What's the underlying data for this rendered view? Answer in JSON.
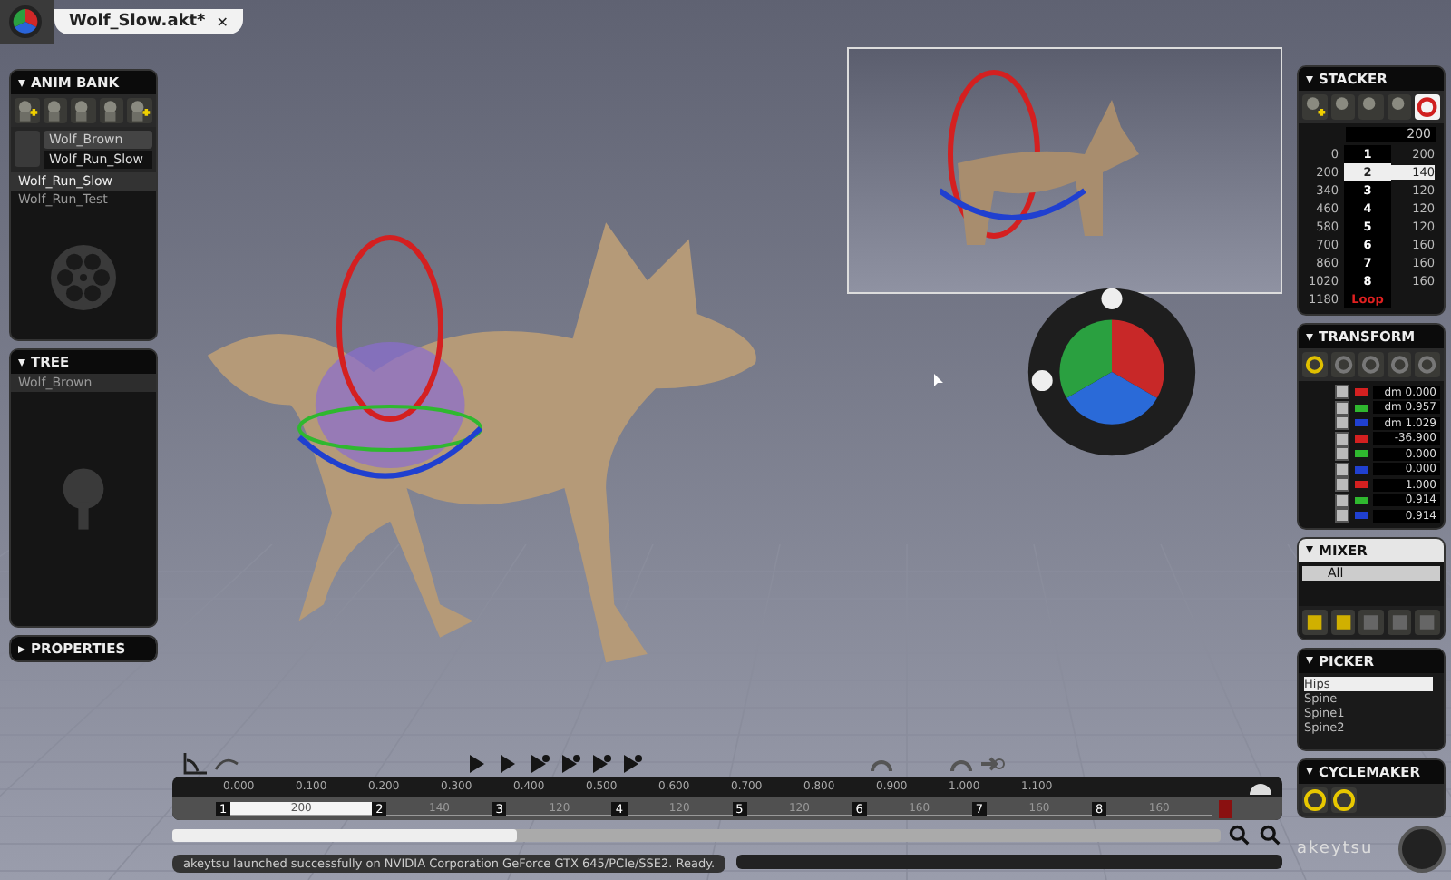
{
  "window": {
    "title": "Wolf_Slow.akt*",
    "close": "✕"
  },
  "anim_bank": {
    "title": "ANIM BANK",
    "expanded": true,
    "character": "Wolf_Brown",
    "current": "Wolf_Run_Slow",
    "items": [
      {
        "label": "Wolf_Run_Slow",
        "selected": true
      },
      {
        "label": "Wolf_Run_Test",
        "selected": false
      }
    ]
  },
  "tree": {
    "title": "TREE",
    "expanded": true,
    "items": [
      {
        "label": "Wolf_Brown"
      }
    ]
  },
  "properties": {
    "title": "PROPERTIES",
    "expanded": false
  },
  "stacker": {
    "title": "STACKER",
    "expanded": true,
    "top_value": "200",
    "rows": [
      {
        "time": "0",
        "clip": "1",
        "duration": "200",
        "kind": "clip",
        "selected": false
      },
      {
        "time": "200",
        "clip": "2",
        "duration": "140",
        "kind": "clip",
        "selected": true
      },
      {
        "time": "340",
        "clip": "3",
        "duration": "120",
        "kind": "clip",
        "selected": false
      },
      {
        "time": "460",
        "clip": "4",
        "duration": "120",
        "kind": "clip",
        "selected": false
      },
      {
        "time": "580",
        "clip": "5",
        "duration": "120",
        "kind": "clip",
        "selected": false
      },
      {
        "time": "700",
        "clip": "6",
        "duration": "160",
        "kind": "clip",
        "selected": false
      },
      {
        "time": "860",
        "clip": "7",
        "duration": "160",
        "kind": "clip",
        "selected": false
      },
      {
        "time": "1020",
        "clip": "8",
        "duration": "160",
        "kind": "clip",
        "selected": false
      },
      {
        "time": "1180",
        "clip": "Loop",
        "kind": "loop",
        "selected": false
      }
    ]
  },
  "transform": {
    "title": "TRANSFORM",
    "expanded": true,
    "rows": [
      {
        "value": "dm 0.000",
        "checked": true,
        "color": "#d42020"
      },
      {
        "value": "dm 0.957",
        "checked": true,
        "color": "#2fb82f"
      },
      {
        "value": "dm 1.029",
        "checked": true,
        "color": "#2040d0"
      },
      {
        "value": "-36.900",
        "checked": true,
        "color": "#d42020"
      },
      {
        "value": "0.000",
        "checked": true,
        "color": "#2fb82f"
      },
      {
        "value": "0.000",
        "checked": true,
        "color": "#2040d0"
      },
      {
        "value": "1.000",
        "checked": true,
        "color": "#d42020"
      },
      {
        "value": "0.914",
        "checked": true,
        "color": "#2fb82f"
      },
      {
        "value": "0.914",
        "checked": true,
        "color": "#2040d0"
      }
    ]
  },
  "mixer": {
    "title": "MIXER",
    "expanded": true,
    "filter": "All"
  },
  "picker": {
    "title": "PICKER",
    "expanded": true,
    "items": [
      {
        "label": "Hips",
        "selected": true
      },
      {
        "label": "Spine",
        "selected": false
      },
      {
        "label": "Spine1",
        "selected": false
      },
      {
        "label": "Spine2",
        "selected": false
      }
    ]
  },
  "cyclemaker": {
    "title": "CYCLEMAKER",
    "expanded": true
  },
  "timeline": {
    "ticks": [
      "0.000",
      "0.100",
      "0.200",
      "0.300",
      "0.400",
      "0.500",
      "0.600",
      "0.700",
      "0.800",
      "0.900",
      "1.000",
      "1.100"
    ],
    "clips": [
      {
        "index": "1",
        "duration": "200",
        "selected": true
      },
      {
        "index": "2",
        "duration": "140",
        "selected": false
      },
      {
        "index": "3",
        "duration": "120",
        "selected": false
      },
      {
        "index": "4",
        "duration": "120",
        "selected": false
      },
      {
        "index": "5",
        "duration": "120",
        "selected": false
      },
      {
        "index": "6",
        "duration": "160",
        "selected": false
      },
      {
        "index": "7",
        "duration": "160",
        "selected": false
      },
      {
        "index": "8",
        "duration": "160",
        "selected": false
      }
    ]
  },
  "status_bar": {
    "message": "akeytsu launched successfully on NVIDIA Corporation GeForce GTX 645/PCIe/SSE2. Ready."
  },
  "brand": "akeytsu"
}
